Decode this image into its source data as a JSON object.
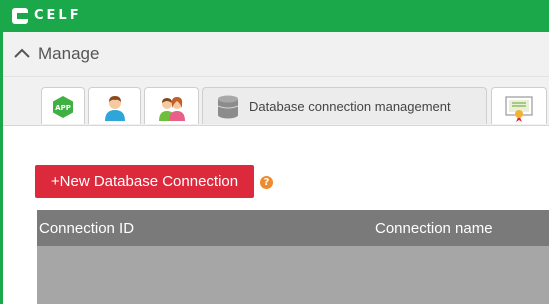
{
  "brand": {
    "name": "CELF",
    "color": "#1aa84a"
  },
  "header": {
    "title": "Manage",
    "icon": "chevron-up-icon"
  },
  "tabs": [
    {
      "icon": "app-icon",
      "badge_text": "APP",
      "label": ""
    },
    {
      "icon": "user-icon",
      "label": ""
    },
    {
      "icon": "users-icon",
      "label": ""
    },
    {
      "icon": "database-icon",
      "label": "Database connection management",
      "active": true
    },
    {
      "icon": "certificate-icon",
      "label": ""
    }
  ],
  "actions": {
    "new_connection_label": "+New Database Connection",
    "help_icon": "?",
    "button_color": "#dc2a3c"
  },
  "table": {
    "columns": [
      "Connection ID",
      "Connection name"
    ],
    "rows": []
  }
}
